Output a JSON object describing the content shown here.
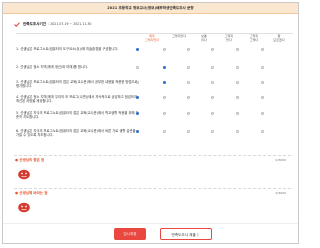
{
  "header": {
    "banner": "2021 초등학교 정보교사(정보)배부학생만족도조사 문항"
  },
  "period": {
    "label": "만족도조사기간",
    "text": ": 2021.07.19 ~ 2021.11.30"
  },
  "survey": {
    "columns": [
      "매우\n그렇지않다",
      "그렇지않다",
      "보통\n이다",
      "그렇지\n않다",
      "그렇지\n그렇다",
      "잘\n모르겠다"
    ],
    "questions": [
      {
        "text": "1. 선생님은 프로그노트(컴퓨터의 도구요소(쉬))에 미술환경을 구성합니다.",
        "selected": 0
      },
      {
        "text": "2. 선생님은 정소 지역(에게 정신(와 미래)를 합니다.",
        "selected": 1
      },
      {
        "text": "3. 선생님은 프로그노트(컴퓨터의 접은 교육(교수준)에서 공부한 내용을 적용한 방법으로 평가합니다.",
        "selected": 1
      },
      {
        "text": "4. 선생님은 정소 지역(에게 우리의 모 프로그(수면)(에서 지속적으로 상담하고 점검하여 최선된 과정을 제공합니다.",
        "selected": 0
      },
      {
        "text": "5. 선생님은 지식의 프로그노트(컴퓨터의 접은 교육(교수준)에서 학교생활 적응을 위해 꾸준히 지도합니다.",
        "selected": 0
      },
      {
        "text": "6. 선생님은 지식의 프로그노트(컴퓨터의 접은 교육(교수준)에서 바른 가로 생활 습관을 가질 수 있도록 지도합니다.",
        "selected": 0
      }
    ]
  },
  "comments": [
    {
      "title": "● 선생님의 좋은 점",
      "counter": "0/3600"
    },
    {
      "title": "● 선생님께 바라는 점",
      "counter": "0/3600"
    }
  ],
  "buttons": {
    "prev": "임시저장",
    "next": "만족도조사 제출 〉"
  },
  "colors": {
    "accent": "#e9473f",
    "selected_radio": "#2f6fcf"
  }
}
